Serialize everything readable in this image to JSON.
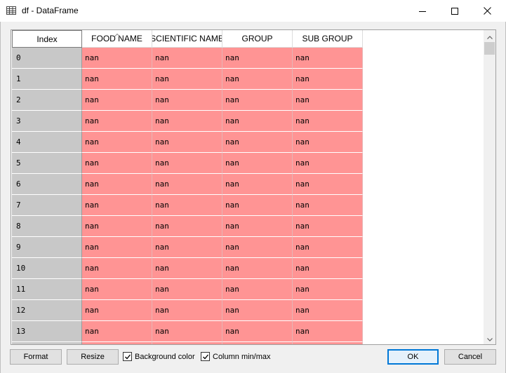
{
  "window": {
    "title": "df - DataFrame",
    "icon": "table-icon",
    "controls": [
      "minimize-icon",
      "maximize-icon",
      "close-icon"
    ]
  },
  "table": {
    "index_header": "Index",
    "columns": [
      "FOOD NAME",
      "SCIENTIFIC NAME",
      "GROUP",
      "SUB GROUP"
    ],
    "sorted_column": "FOOD NAME",
    "rows": [
      {
        "index": "0",
        "values": [
          "nan",
          "nan",
          "nan",
          "nan"
        ]
      },
      {
        "index": "1",
        "values": [
          "nan",
          "nan",
          "nan",
          "nan"
        ]
      },
      {
        "index": "2",
        "values": [
          "nan",
          "nan",
          "nan",
          "nan"
        ]
      },
      {
        "index": "3",
        "values": [
          "nan",
          "nan",
          "nan",
          "nan"
        ]
      },
      {
        "index": "4",
        "values": [
          "nan",
          "nan",
          "nan",
          "nan"
        ]
      },
      {
        "index": "5",
        "values": [
          "nan",
          "nan",
          "nan",
          "nan"
        ]
      },
      {
        "index": "6",
        "values": [
          "nan",
          "nan",
          "nan",
          "nan"
        ]
      },
      {
        "index": "7",
        "values": [
          "nan",
          "nan",
          "nan",
          "nan"
        ]
      },
      {
        "index": "8",
        "values": [
          "nan",
          "nan",
          "nan",
          "nan"
        ]
      },
      {
        "index": "9",
        "values": [
          "nan",
          "nan",
          "nan",
          "nan"
        ]
      },
      {
        "index": "10",
        "values": [
          "nan",
          "nan",
          "nan",
          "nan"
        ]
      },
      {
        "index": "11",
        "values": [
          "nan",
          "nan",
          "nan",
          "nan"
        ]
      },
      {
        "index": "12",
        "values": [
          "nan",
          "nan",
          "nan",
          "nan"
        ]
      },
      {
        "index": "13",
        "values": [
          "nan",
          "nan",
          "nan",
          "nan"
        ]
      },
      {
        "index": "",
        "values": [
          "",
          "",
          "",
          ""
        ]
      }
    ],
    "colors": {
      "index_bg": "#c8c8c8",
      "cell_bg": "#ff9494"
    }
  },
  "buttons": {
    "format": "Format",
    "resize": "Resize",
    "ok": "OK",
    "cancel": "Cancel"
  },
  "checkboxes": {
    "background_color": {
      "label": "Background color",
      "checked": true
    },
    "column_minmax": {
      "label": "Column min/max",
      "checked": true
    }
  },
  "accent_color": "#0078d7"
}
